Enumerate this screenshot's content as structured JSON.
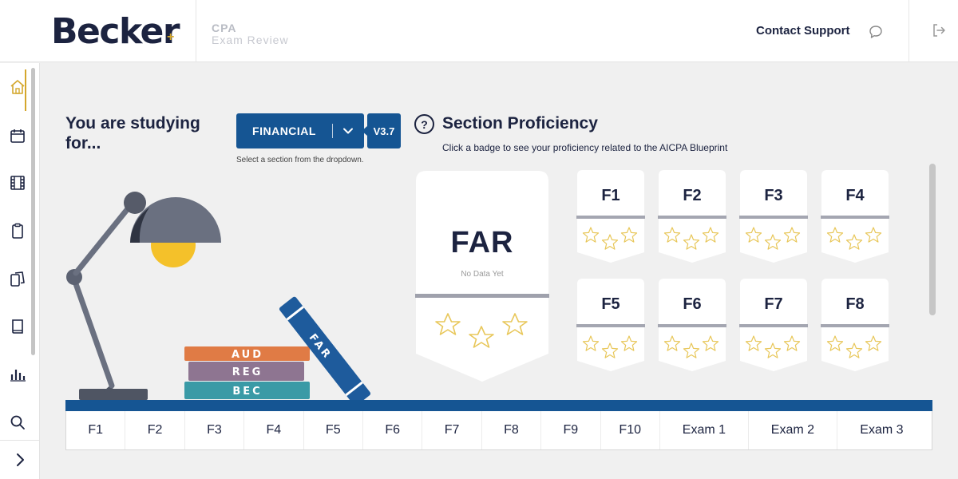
{
  "header": {
    "logo": "Becker",
    "logo_mark": "+",
    "product_line1": "CPA",
    "product_line2": "Exam Review",
    "contact_support": "Contact Support",
    "chat_icon": "chat-bubble-icon",
    "logout_icon": "logout-icon"
  },
  "sidebar": {
    "items": [
      {
        "icon": "home-icon",
        "active": true
      },
      {
        "icon": "calendar-icon"
      },
      {
        "icon": "film-icon"
      },
      {
        "icon": "clipboard-icon"
      },
      {
        "icon": "flashcards-icon"
      },
      {
        "icon": "book-icon"
      },
      {
        "icon": "bar-chart-icon"
      },
      {
        "icon": "search-icon"
      }
    ],
    "expand_icon": "chevron-right-icon"
  },
  "studying": {
    "heading_line1": "You are studying",
    "heading_line2": "for...",
    "section_select": "FINANCIAL",
    "version": "V3.7",
    "hint": "Select a section from the dropdown."
  },
  "proficiency": {
    "title": "Section Proficiency",
    "subtitle": "Click a badge to see your proficiency related to the AICPA Blueprint",
    "main_badge": {
      "label": "FAR",
      "status": "No Data Yet"
    },
    "badges": [
      "F1",
      "F2",
      "F3",
      "F4",
      "F5",
      "F6",
      "F7",
      "F8"
    ]
  },
  "illustration": {
    "books": [
      "AUD",
      "REG",
      "BEC"
    ],
    "leaning_book": "FAR",
    "book_colors": {
      "AUD": "#e07b45",
      "REG": "#8e7591",
      "BEC": "#3a9aa6",
      "FAR": "#1e5b9c"
    }
  },
  "tabs": [
    "F1",
    "F2",
    "F3",
    "F4",
    "F5",
    "F6",
    "F7",
    "F8",
    "F9",
    "F10",
    "Exam 1",
    "Exam 2",
    "Exam 3"
  ],
  "colors": {
    "primary": "#155593",
    "navy": "#1c2340",
    "gold": "#d4a72c"
  }
}
